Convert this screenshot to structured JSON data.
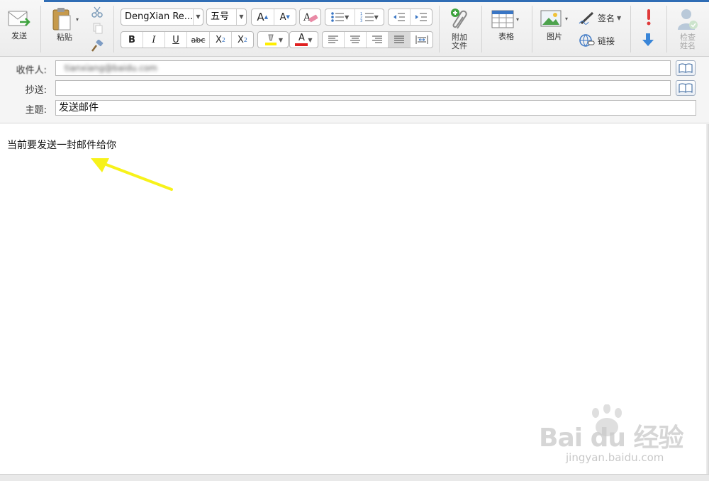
{
  "toolbar": {
    "send": "发送",
    "paste": "粘贴",
    "font_name": "DengXian Re...",
    "font_size": "五号",
    "grow_font": "A",
    "shrink_font": "A",
    "bold": "B",
    "italic": "I",
    "underline": "U",
    "strike": "abc",
    "subscript_base": "X",
    "subscript_mark": "2",
    "superscript_base": "X",
    "superscript_mark": "2",
    "font_color_letter": "A",
    "attach_line1": "附加",
    "attach_line2": "文件",
    "table": "表格",
    "picture": "图片",
    "signature": "签名",
    "link": "链接",
    "check_names_line1": "检查",
    "check_names_line2": "姓名"
  },
  "colors": {
    "accent": "#2f6db5",
    "highlight": "#ffee00",
    "font_color": "#e02020",
    "arrow": "#f7f21a",
    "important": "#e03a3a",
    "low_importance": "#3a86d8"
  },
  "header": {
    "to_label": "收件人:",
    "to_value": "tianxiang@baidu.com",
    "cc_label": "抄送:",
    "cc_value": "",
    "subject_label": "主题:",
    "subject_value": "发送邮件"
  },
  "body": {
    "text": "当前要发送一封邮件给你"
  },
  "watermark": {
    "brand": "Bai du 经验",
    "sub": "jingyan.baidu.com"
  }
}
